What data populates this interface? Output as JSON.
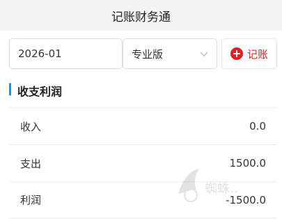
{
  "app": {
    "title": "记账财务通"
  },
  "filters": {
    "date_value": "2026-01",
    "edition_value": "专业版",
    "add_label": "记账"
  },
  "section": {
    "title": "收支利润"
  },
  "rows": [
    {
      "label": "收入",
      "value": "0.0"
    },
    {
      "label": "支出",
      "value": "1500.0"
    },
    {
      "label": "利润",
      "value": "-1500.0"
    }
  ],
  "watermark": {
    "text": "蜘蛛…"
  },
  "colors": {
    "accent": "#2b8cf0",
    "add": "#e02020",
    "topbar": "#f4f4f4"
  }
}
